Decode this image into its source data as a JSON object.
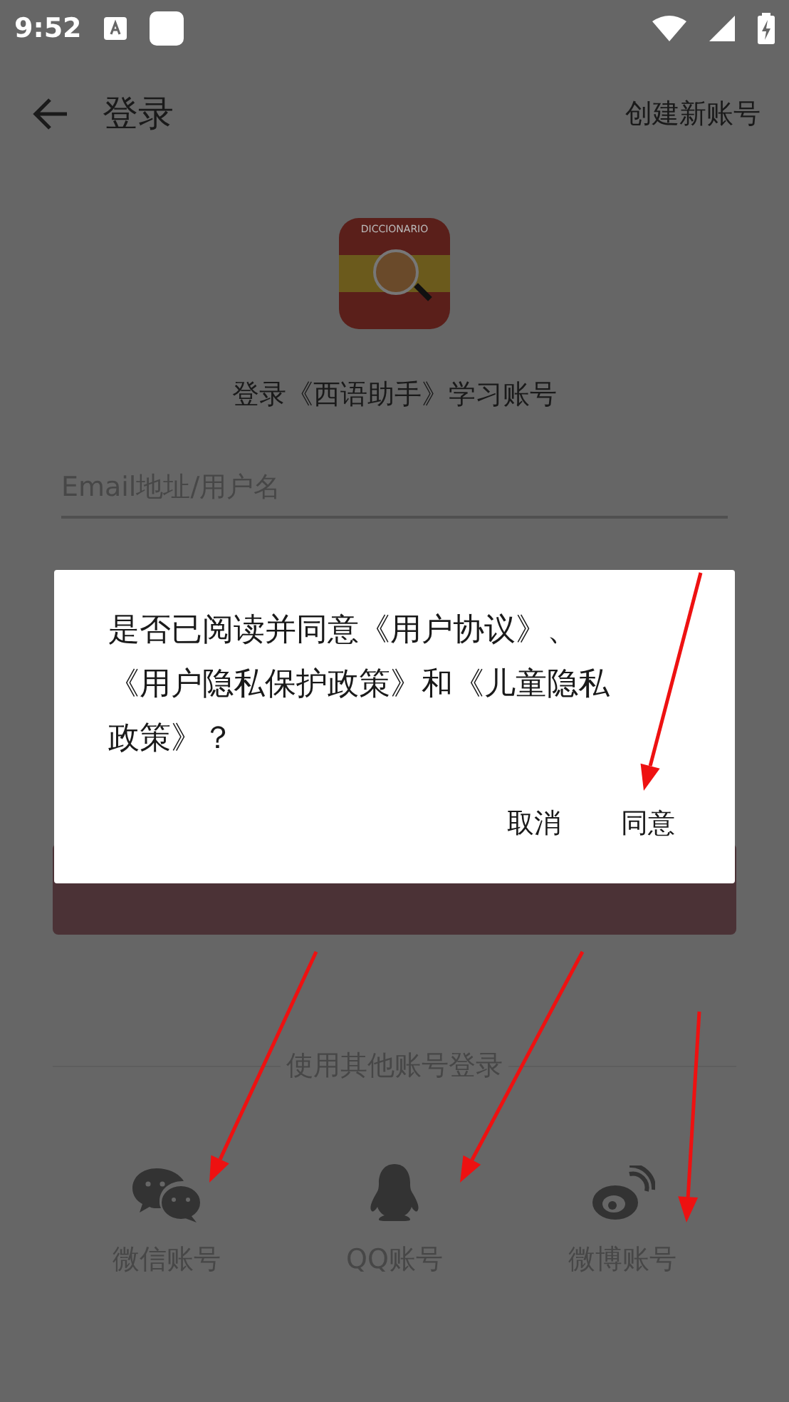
{
  "status_bar": {
    "time": "9:52"
  },
  "app_bar": {
    "title": "登录",
    "action": "创建新账号"
  },
  "logo": {
    "text": "DICCIONARIO"
  },
  "subtitle": "登录《西语助手》学习账号",
  "email_field": {
    "placeholder": "Email地址/用户名"
  },
  "other_login": {
    "label": "使用其他账号登录",
    "options": [
      {
        "kind": "wechat",
        "label": "微信账号"
      },
      {
        "kind": "qq",
        "label": "QQ账号"
      },
      {
        "kind": "weibo",
        "label": "微博账号"
      }
    ]
  },
  "dialog": {
    "message": "是否已阅读并同意《用户协议》、《用户隐私保护政策》和《儿童隐私政策》？",
    "buttons": [
      "取消",
      "同意"
    ]
  }
}
